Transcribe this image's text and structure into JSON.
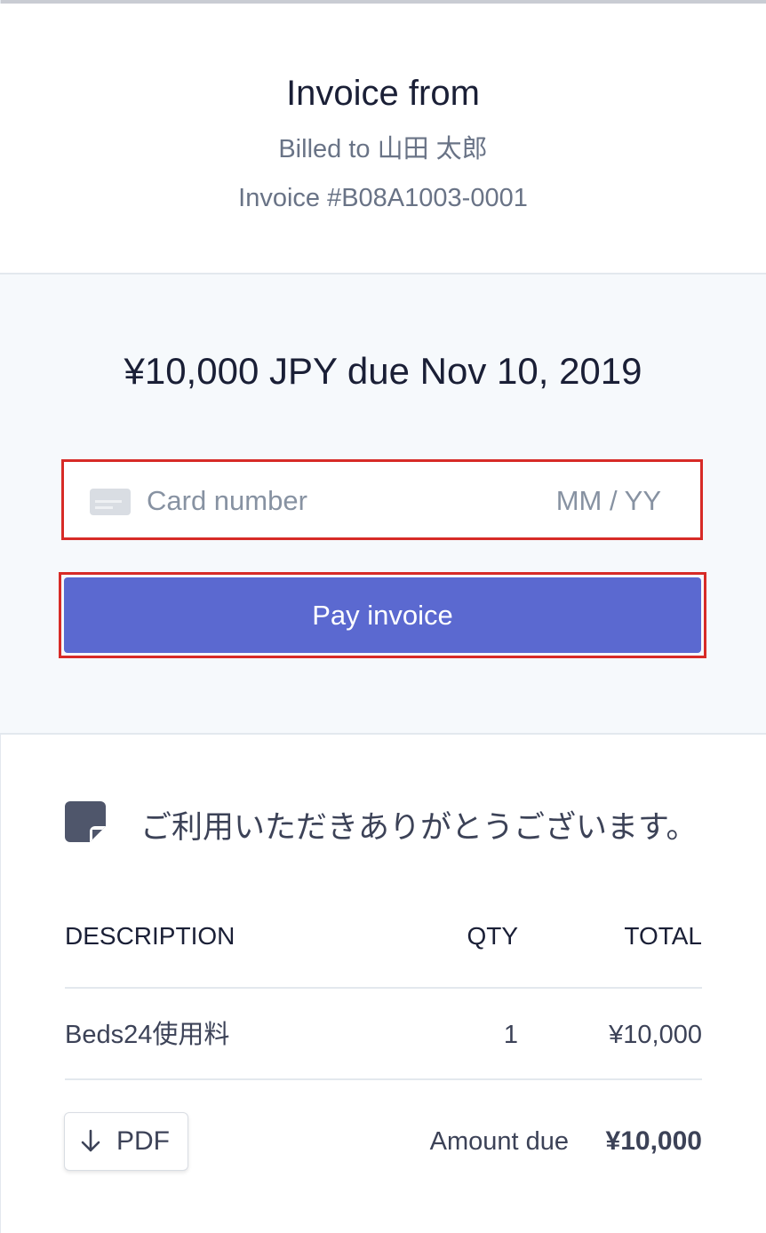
{
  "header": {
    "title": "Invoice from",
    "billed_to": "Billed to 山田 太郎",
    "invoice_number": "Invoice #B08A1003-0001"
  },
  "payment": {
    "amount_heading": "¥10,000 JPY due Nov 10, 2019",
    "card_number_placeholder": "Card number",
    "expiry_placeholder": "MM / YY",
    "pay_button_label": "Pay invoice"
  },
  "memo": {
    "icon": "note-icon",
    "text": "ご利用いただきありがとうございます。"
  },
  "line_items": {
    "columns": [
      "DESCRIPTION",
      "QTY",
      "TOTAL"
    ],
    "rows": [
      {
        "description": "Beds24使用料",
        "qty": "1",
        "total": "¥10,000"
      }
    ]
  },
  "footer": {
    "pdf_label": "PDF",
    "pdf_icon": "arrow-down-icon",
    "amount_due_label": "Amount due",
    "amount_due_value": "¥10,000"
  },
  "colors": {
    "accent": "#5b69d0",
    "highlight_border": "#d72b27",
    "panel_background": "#f6f9fc"
  }
}
